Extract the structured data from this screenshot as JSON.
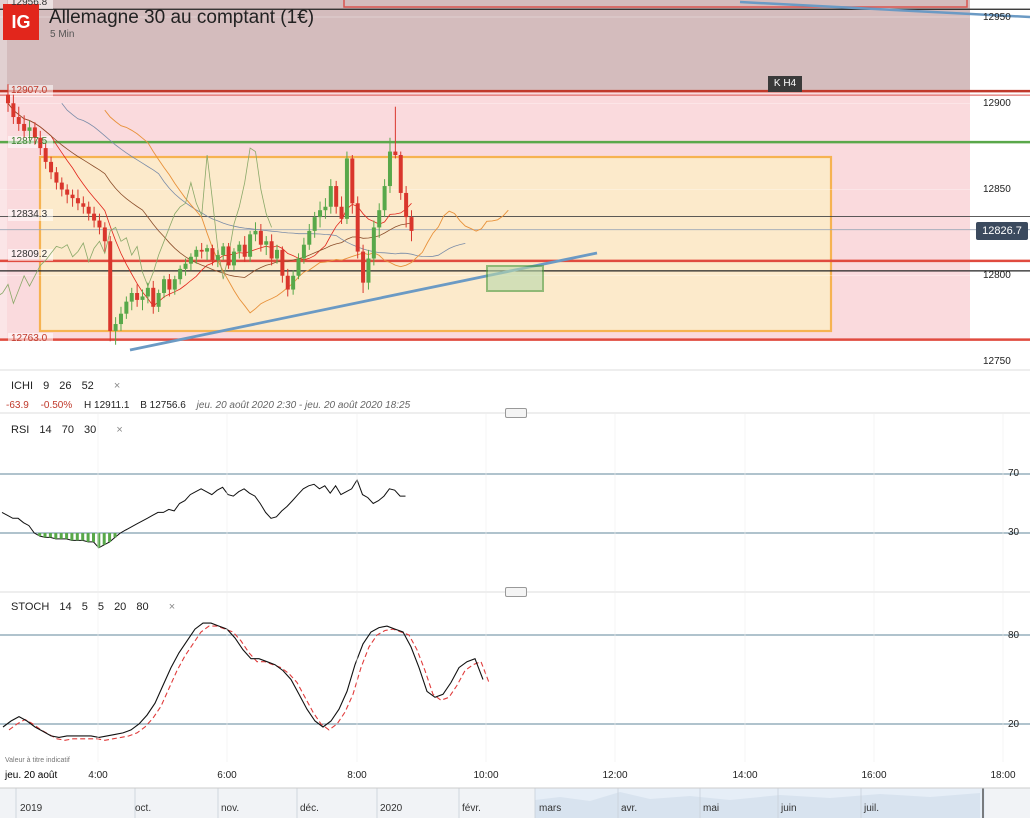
{
  "header": {
    "logo": "IG",
    "title": "Allemagne 30 au comptant (1€)",
    "interval": "5 Min"
  },
  "price_tag": "12826.7",
  "zone_label": "K H4",
  "levels": [
    {
      "label": "12956.8",
      "value": 12956.8,
      "color": "#333333"
    },
    {
      "label": "12907.0",
      "value": 12907.0,
      "color": "#d9534f"
    },
    {
      "label": "12877.5",
      "value": 12877.5,
      "color": "#4a9a3e"
    },
    {
      "label": "12834.3",
      "value": 12834.3,
      "color": "#555555"
    },
    {
      "label": "12809.2",
      "value": 12809.2,
      "color": "#555555"
    },
    {
      "label": "12763.0",
      "value": 12763.0,
      "color": "#d9534f"
    }
  ],
  "ichi": {
    "label": "ICHI",
    "params": [
      "9",
      "26",
      "52"
    ],
    "change": "-63.9",
    "change_pct": "-0.50%",
    "high": "H 12911.1",
    "low": "B 12756.6",
    "range": "jeu. 20 août 2020 2:30 - jeu. 20 août 2020 18:25"
  },
  "rsi": {
    "label": "RSI",
    "params": [
      "14",
      "70",
      "30"
    ],
    "levels": [
      "70",
      "30"
    ]
  },
  "stoch": {
    "label": "STOCH",
    "params": [
      "14",
      "5",
      "5",
      "20",
      "80"
    ],
    "levels": [
      "80",
      "20"
    ]
  },
  "note": "Valeur à titre indicatif",
  "time_axis": {
    "date": "jeu. 20 août",
    "labels": [
      "4:00",
      "6:00",
      "8:00",
      "10:00",
      "12:00",
      "14:00",
      "16:00",
      "18:00"
    ]
  },
  "navigator": [
    "2019",
    "oct.",
    "nov.",
    "déc.",
    "2020",
    "févr.",
    "mars",
    "avr.",
    "mai",
    "juin",
    "juil."
  ],
  "chart_data": {
    "type": "candlestick",
    "title": "Allemagne 30 au comptant (1€)",
    "price_axis": {
      "ticks": [
        12950,
        12900,
        12850,
        12800,
        12750
      ],
      "range": [
        12730,
        12970
      ]
    },
    "time_axis": {
      "start": "02:30",
      "interval_minutes": 5
    },
    "candles": [
      [
        12905,
        12911,
        12895,
        12900
      ],
      [
        12900,
        12905,
        12888,
        12892
      ],
      [
        12892,
        12898,
        12884,
        12888
      ],
      [
        12888,
        12893,
        12880,
        12884
      ],
      [
        12884,
        12890,
        12878,
        12886
      ],
      [
        12886,
        12889,
        12876,
        12880
      ],
      [
        12880,
        12884,
        12870,
        12874
      ],
      [
        12874,
        12877,
        12862,
        12866
      ],
      [
        12866,
        12869,
        12856,
        12860
      ],
      [
        12860,
        12863,
        12850,
        12854
      ],
      [
        12854,
        12857,
        12846,
        12850
      ],
      [
        12850,
        12853,
        12842,
        12847
      ],
      [
        12847,
        12850,
        12840,
        12845
      ],
      [
        12845,
        12850,
        12838,
        12842
      ],
      [
        12842,
        12846,
        12836,
        12840
      ],
      [
        12840,
        12843,
        12832,
        12836
      ],
      [
        12836,
        12840,
        12828,
        12832
      ],
      [
        12832,
        12836,
        12824,
        12828
      ],
      [
        12828,
        12831,
        12814,
        12820
      ],
      [
        12820,
        12823,
        12762,
        12768
      ],
      [
        12768,
        12776,
        12760,
        12772
      ],
      [
        12772,
        12782,
        12768,
        12778
      ],
      [
        12778,
        12788,
        12775,
        12785
      ],
      [
        12785,
        12793,
        12780,
        12790
      ],
      [
        12790,
        12795,
        12782,
        12786
      ],
      [
        12786,
        12792,
        12780,
        12788
      ],
      [
        12788,
        12796,
        12784,
        12793
      ],
      [
        12793,
        12797,
        12778,
        12782
      ],
      [
        12782,
        12792,
        12779,
        12790
      ],
      [
        12790,
        12800,
        12787,
        12798
      ],
      [
        12798,
        12801,
        12788,
        12792
      ],
      [
        12792,
        12800,
        12789,
        12798
      ],
      [
        12798,
        12806,
        12795,
        12804
      ],
      [
        12804,
        12810,
        12800,
        12807
      ],
      [
        12807,
        12813,
        12803,
        12811
      ],
      [
        12811,
        12817,
        12807,
        12815
      ],
      [
        12815,
        12819,
        12810,
        12814
      ],
      [
        12814,
        12818,
        12809,
        12816
      ],
      [
        12816,
        12818,
        12806,
        12809
      ],
      [
        12809,
        12815,
        12805,
        12812
      ],
      [
        12812,
        12819,
        12809,
        12817
      ],
      [
        12817,
        12819,
        12804,
        12806
      ],
      [
        12806,
        12816,
        12803,
        12814
      ],
      [
        12814,
        12820,
        12810,
        12818
      ],
      [
        12818,
        12823,
        12808,
        12811
      ],
      [
        12811,
        12826,
        12808,
        12824
      ],
      [
        12824,
        12831,
        12820,
        12826
      ],
      [
        12826,
        12830,
        12814,
        12818
      ],
      [
        12818,
        12823,
        12812,
        12820
      ],
      [
        12820,
        12824,
        12806,
        12810
      ],
      [
        12810,
        12818,
        12807,
        12815
      ],
      [
        12815,
        12817,
        12796,
        12800
      ],
      [
        12800,
        12804,
        12788,
        12792
      ],
      [
        12792,
        12803,
        12789,
        12800
      ],
      [
        12800,
        12813,
        12798,
        12810
      ],
      [
        12810,
        12822,
        12807,
        12818
      ],
      [
        12818,
        12830,
        12815,
        12826
      ],
      [
        12826,
        12837,
        12822,
        12834
      ],
      [
        12834,
        12843,
        12828,
        12838
      ],
      [
        12838,
        12845,
        12833,
        12840
      ],
      [
        12840,
        12856,
        12836,
        12852
      ],
      [
        12852,
        12855,
        12836,
        12840
      ],
      [
        12840,
        12846,
        12830,
        12833
      ],
      [
        12833,
        12872,
        12830,
        12868
      ],
      [
        12868,
        12870,
        12836,
        12842
      ],
      [
        12842,
        12846,
        12810,
        12814
      ],
      [
        12814,
        12818,
        12790,
        12796
      ],
      [
        12796,
        12815,
        12792,
        12810
      ],
      [
        12810,
        12832,
        12806,
        12828
      ],
      [
        12828,
        12842,
        12822,
        12838
      ],
      [
        12838,
        12856,
        12834,
        12852
      ],
      [
        12852,
        12880,
        12848,
        12872
      ],
      [
        12872,
        12898,
        12868,
        12870
      ],
      [
        12870,
        12872,
        12844,
        12848
      ],
      [
        12848,
        12852,
        12828,
        12834
      ],
      [
        12834,
        12838,
        12820,
        12826
      ]
    ],
    "rsi": {
      "levels": [
        70,
        30
      ],
      "values": [
        44,
        42,
        40,
        40,
        37,
        35,
        30,
        28,
        27,
        27,
        26,
        26,
        26,
        25,
        25,
        25,
        24,
        24,
        20,
        22,
        24,
        27,
        30,
        32,
        34,
        36,
        38,
        40,
        42,
        44,
        44,
        46,
        45,
        50,
        52,
        56,
        58,
        60,
        58,
        56,
        59,
        61,
        56,
        55,
        58,
        60,
        57,
        55,
        50,
        44,
        40,
        41,
        45,
        48,
        52,
        56,
        60,
        62,
        63,
        60,
        62,
        57,
        62,
        56,
        58,
        60,
        66,
        56,
        54,
        50,
        52,
        55,
        60,
        59,
        55,
        55
      ]
    },
    "stoch": {
      "levels": [
        80,
        20
      ],
      "k": [
        18,
        22,
        25,
        22,
        18,
        15,
        12,
        11,
        12,
        12,
        12,
        12,
        11,
        12,
        13,
        14,
        16,
        20,
        26,
        34,
        46,
        58,
        68,
        76,
        84,
        88,
        88,
        86,
        84,
        78,
        70,
        64,
        64,
        62,
        60,
        56,
        50,
        40,
        30,
        22,
        18,
        22,
        30,
        42,
        60,
        74,
        82,
        85,
        86,
        84,
        82,
        72,
        58,
        42,
        38,
        40,
        48,
        58,
        62,
        64,
        50
      ]
    }
  }
}
